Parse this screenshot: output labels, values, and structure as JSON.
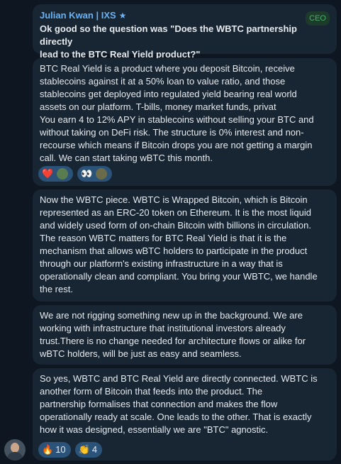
{
  "header": {
    "sender": "Julian Kwan | IXS",
    "badge": "CEO",
    "star_icon": "star-icon"
  },
  "messages": [
    {
      "text": "Ok good so the question was \"Does the WBTC partnership directly\nlead to the BTC Real Yield product?\""
    },
    {
      "text": "BTC Real Yield is a product where you deposit Bitcoin, receive\nstablecoins against it at a 50% loan to value ratio, and those\nstablecoins get deployed into regulated yield bearing real world\nassets on our platform. T-bills, money market funds, privat\nYou earn 4 to 12% APY in stablecoins without selling your BTC and\nwithout taking on DeFi risk. The structure is 0% interest and non-\nrecourse which means if Bitcoin drops you are not getting a margin\ncall. We can start taking wBTC this month."
    },
    {
      "text": "Now the WBTC piece. WBTC is Wrapped Bitcoin, which is Bitcoin\nrepresented as an ERC-20 token on Ethereum. It is the most liquid\nand widely used form of on-chain Bitcoin with billions in circulation.\nThe reason WBTC matters for BTC Real Yield is that it is the\nmechanism that allows wBTC holders to participate in the product\nthrough our platform's existing infrastructure in a way that is\noperationally clean and compliant. You bring your WBTC, we handle\nthe rest."
    },
    {
      "text": "We are not rigging something new up in the background. We are\nworking with infrastructure that institutional investors already\ntrust.There is no change needed for architecture flows or alike for\nwBTC holders, will be just as easy and seamless."
    },
    {
      "text": "So yes, WBTC and BTC Real Yield are directly connected. WBTC is\nanother form of Bitcoin that feeds into the product. The\npartnership formalises that connection and makes the flow\noperationally ready at scale. One leads to the other. That is exactly\nhow it was designed, essentially we are \"BTC\" agnostic."
    }
  ],
  "reactions_b2": [
    {
      "emoji": "❤️",
      "icon": "heart-icon"
    },
    {
      "emoji": "👀",
      "icon": "eyes-icon"
    }
  ],
  "reactions_b5": [
    {
      "emoji": "🔥",
      "count": "10",
      "icon": "fire-icon"
    },
    {
      "emoji": "👏",
      "count": "4",
      "icon": "clap-icon"
    }
  ]
}
